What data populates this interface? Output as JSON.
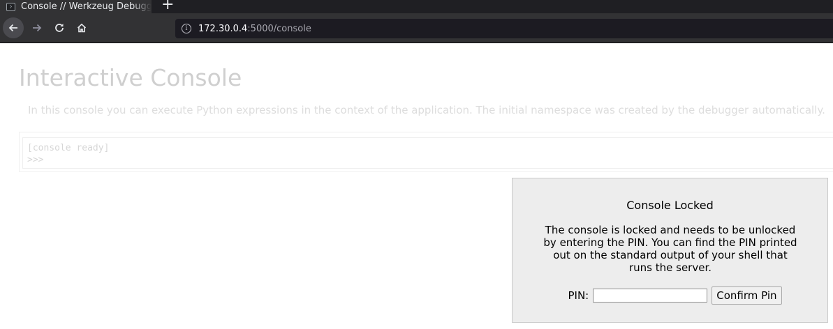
{
  "browser": {
    "tab_title": "Console // Werkzeug Debugger",
    "new_tab_label": "+",
    "url_host": "172.30.0.4",
    "url_rest": ":5000/console",
    "icons": {
      "favicon": "terminal-icon",
      "back": "back-arrow-icon",
      "forward": "forward-arrow-icon",
      "reload": "reload-icon",
      "home": "home-icon",
      "site_info": "info-icon"
    }
  },
  "page": {
    "title": "Interactive Console",
    "intro": "In this console you can execute Python expressions in the context of the application. The initial namespace was created by the debugger automatically.",
    "console_lines": [
      "[console ready]",
      ">>>"
    ]
  },
  "lock_dialog": {
    "title": "Console Locked",
    "message": "The console is locked and needs to be unlocked by entering the PIN. You can find the PIN printed out on the standard output of your shell that runs the server.",
    "pin_label": "PIN:",
    "pin_value": "",
    "confirm_label": "Confirm Pin"
  }
}
